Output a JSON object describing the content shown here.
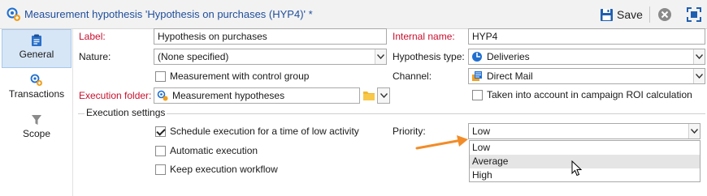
{
  "window": {
    "title": "Measurement hypothesis 'Hypothesis on purchases (HYP4)' *",
    "title_icon": "hypothesis-icon"
  },
  "toolbar": {
    "save_label": "Save",
    "save_icon": "floppy-disk-icon",
    "close_icon": "close-circle-icon",
    "expand_icon": "expand-icon"
  },
  "sidebar": {
    "items": [
      {
        "label": "General",
        "icon": "clipboard-icon",
        "active": true
      },
      {
        "label": "Transactions",
        "icon": "transactions-icon",
        "active": false
      },
      {
        "label": "Scope",
        "icon": "filter-funnel-icon",
        "active": false
      }
    ]
  },
  "form": {
    "label": {
      "label": "Label:",
      "value": "Hypothesis on purchases"
    },
    "internal_name": {
      "label": "Internal name:",
      "value": "HYP4"
    },
    "nature": {
      "label": "Nature:",
      "value": "(None specified)"
    },
    "hypothesis_type": {
      "label": "Hypothesis type:",
      "value": "Deliveries"
    },
    "control_group": {
      "label": "Measurement with control group",
      "checked": false
    },
    "channel": {
      "label": "Channel:",
      "value": "Direct Mail"
    },
    "execution_folder": {
      "label": "Execution folder:",
      "value": "Measurement hypotheses"
    },
    "roi": {
      "label": "Taken into account in campaign ROI calculation",
      "checked": false
    }
  },
  "execution_settings": {
    "title": "Execution settings",
    "schedule": {
      "label": "Schedule execution for a time of low activity",
      "checked": true
    },
    "automatic": {
      "label": "Automatic execution",
      "checked": false
    },
    "keep_workflow": {
      "label": "Keep execution workflow",
      "checked": false
    },
    "priority": {
      "label": "Priority:",
      "value": "Low",
      "options": [
        "Low",
        "Average",
        "High"
      ],
      "hovered": "Average"
    }
  },
  "colors": {
    "required_label": "#c8102e",
    "title_text": "#1f4e9c",
    "active_nav_bg": "#d6e6f7",
    "annotation_arrow": "#f28c28"
  }
}
